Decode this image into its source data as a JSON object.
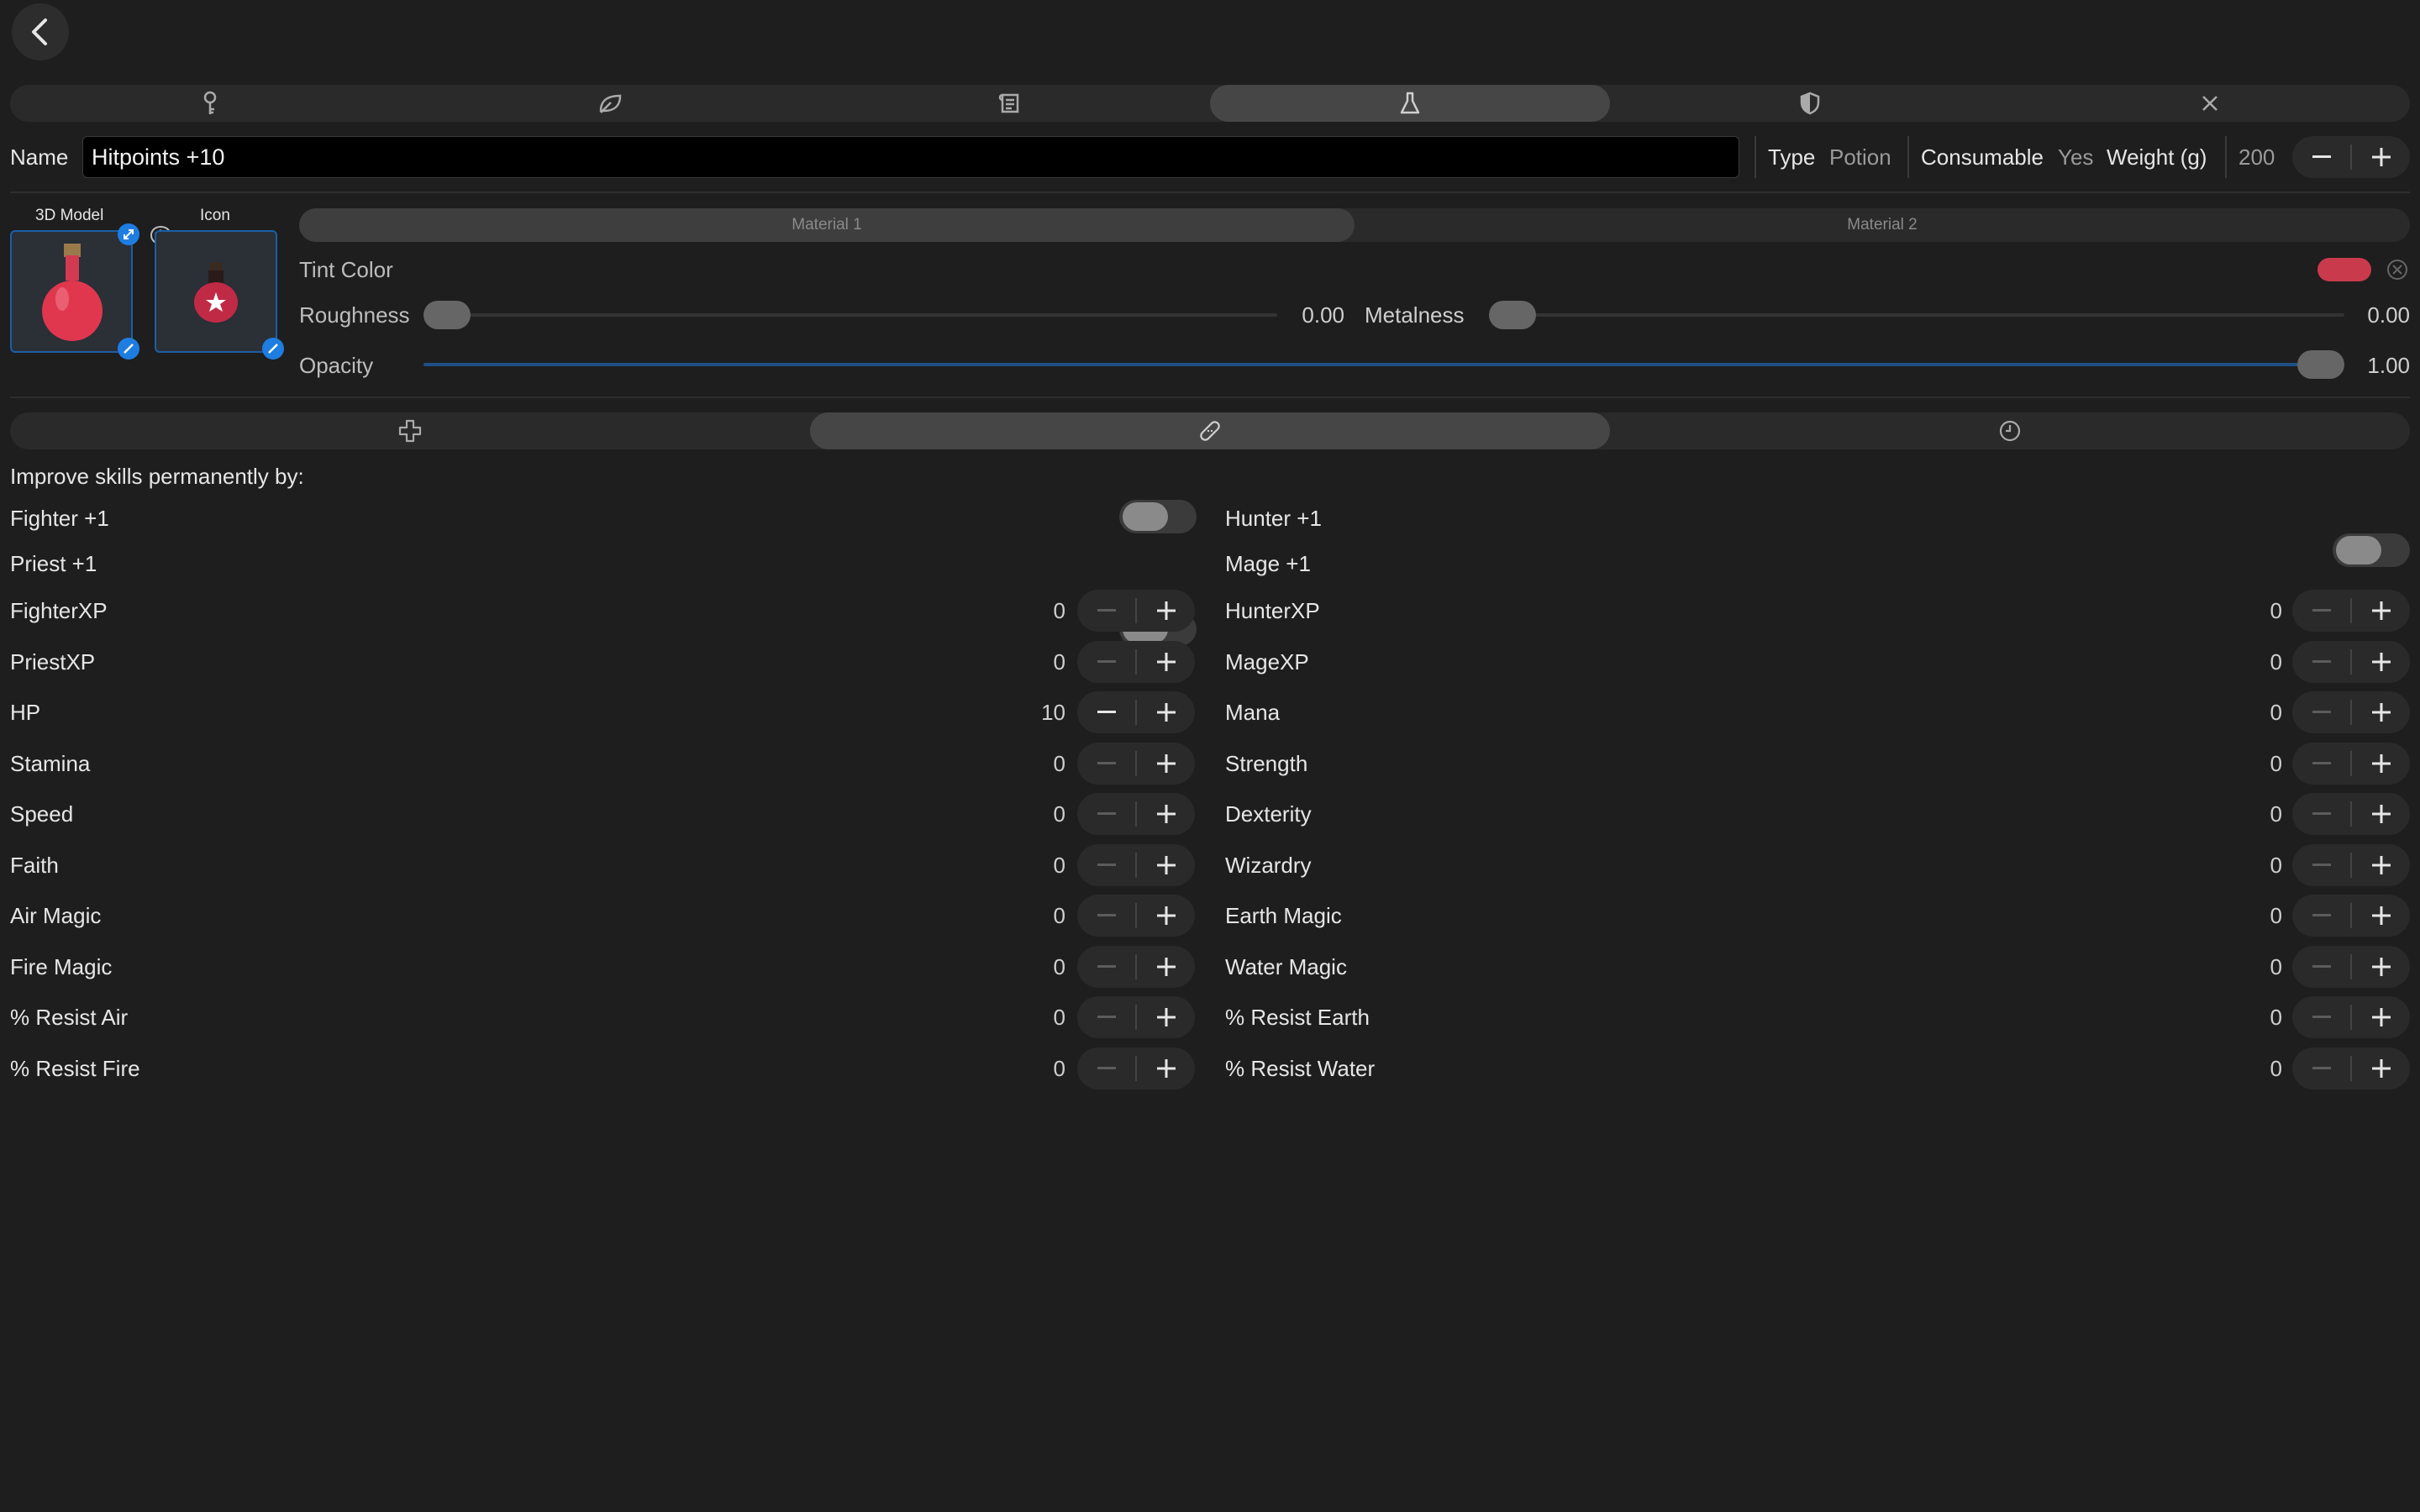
{
  "top_tabs": [
    "key-icon",
    "leaf-icon",
    "scroll-icon",
    "flask-icon",
    "shield-icon",
    "close-icon"
  ],
  "header": {
    "name_label": "Name",
    "name_value": "Hitpoints +10",
    "type_label": "Type",
    "type_value": "Potion",
    "consumable_label": "Consumable",
    "consumable_value": "Yes",
    "weight_label": "Weight (g)",
    "weight_value": "200"
  },
  "assets": {
    "model_label": "3D Model",
    "icon_label": "Icon"
  },
  "material": {
    "tabs": [
      "Material 1",
      "Material 2"
    ],
    "tint_label": "Tint Color",
    "tint_color": "#c93a4c",
    "roughness_label": "Roughness",
    "roughness_value": "0.00",
    "roughness_level": 0.0,
    "metalness_label": "Metalness",
    "metalness_value": "0.00",
    "metalness_level": 0.0,
    "opacity_label": "Opacity",
    "opacity_value": "1.00",
    "opacity_level": 1.0
  },
  "sub_tabs": [
    "plus-cross-icon",
    "bandage-icon",
    "clock-icon"
  ],
  "effects": {
    "heading": "Improve skills permanently by:",
    "toggles": {
      "left": [
        "Fighter +1",
        "Priest +1"
      ],
      "right": [
        "Hunter +1",
        "Mage +1"
      ]
    },
    "steppers_left": [
      {
        "label": "FighterXP",
        "value": "0"
      },
      {
        "label": "PriestXP",
        "value": "0"
      },
      {
        "label": "HP",
        "value": "10"
      },
      {
        "label": "Stamina",
        "value": "0"
      },
      {
        "label": "Speed",
        "value": "0"
      },
      {
        "label": "Faith",
        "value": "0"
      },
      {
        "label": "Air Magic",
        "value": "0"
      },
      {
        "label": "Fire Magic",
        "value": "0"
      },
      {
        "label": "% Resist Air",
        "value": "0"
      },
      {
        "label": "% Resist Fire",
        "value": "0"
      }
    ],
    "steppers_right": [
      {
        "label": "HunterXP",
        "value": "0"
      },
      {
        "label": "MageXP",
        "value": "0"
      },
      {
        "label": "Mana",
        "value": "0"
      },
      {
        "label": "Strength",
        "value": "0"
      },
      {
        "label": "Dexterity",
        "value": "0"
      },
      {
        "label": "Wizardry",
        "value": "0"
      },
      {
        "label": "Earth Magic",
        "value": "0"
      },
      {
        "label": "Water Magic",
        "value": "0"
      },
      {
        "label": "% Resist Earth",
        "value": "0"
      },
      {
        "label": "% Resist Water",
        "value": "0"
      }
    ]
  }
}
